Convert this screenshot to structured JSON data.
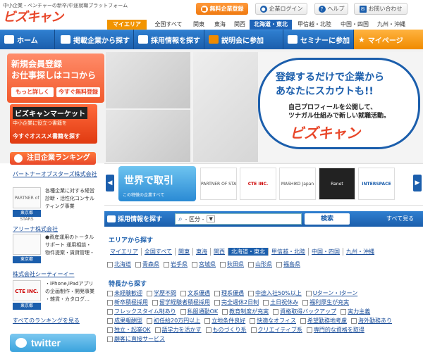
{
  "header": {
    "tagline": "中小企業・ベンチャーの新卒/中途就職プラットフォーム",
    "logo": "ビズキャン",
    "register_label": "無料企業登録",
    "login_label": "企業ログイン",
    "help_label": "ヘルプ",
    "contact_label": "お問い合わせ"
  },
  "regions": [
    "マイエリア",
    "全国すべて",
    "関東",
    "東海",
    "関西",
    "北海道・東北",
    "甲信越・北陸",
    "中国・四国",
    "九州・沖縄"
  ],
  "nav": {
    "home": "ホーム",
    "companies": "掲載企業から探す",
    "jobs": "採用情報を探す",
    "seminar": "説明会に参加",
    "seminar2": "セミナーに参加",
    "mypage": "マイページ"
  },
  "hero": {
    "signup_line1": "新規会員登録",
    "signup_line2": "お仕事探しはココから",
    "more": "もっと詳しく",
    "free_register": "今すぐ無料登録",
    "market_title": "ビズキャンマーケット",
    "market_sub": "中小企業に役立つ書籍を",
    "market_link": "今すぐオススメ書籍を探す",
    "bubble_line1": "登録するだけで企業から",
    "bubble_line2": "あなたにスカウトも!!",
    "bubble_line3": "自己プロフィールを公開して、",
    "bubble_line4": "ツナガル仕組みで新しい就職活動。",
    "bubble_logo": "ビズキャン"
  },
  "ranking": {
    "title": "注目企業ランキング",
    "items": [
      {
        "name": "パートナーオブスターズ株式会社",
        "logo": "PARTNER of STARS",
        "loc": "東京都",
        "desc": "各種企業に対する経営診断・活性化コンサルティング事業"
      },
      {
        "name": "アリーナ株式会社",
        "logo": "",
        "loc": "東京都",
        "desc": "●資産運用のトータルサポート 運用相談・物件提案・賃貸管理・"
      },
      {
        "name": "株式会社シーティーイー",
        "logo": "CTE INC.",
        "loc": "東京都",
        "desc": "・iPhone,iPadアプリの企画制作・開発事業 ・雑貨・カタログ…"
      }
    ],
    "all_link": "すべてのランキングを見る"
  },
  "twitter": "twitter",
  "strip": {
    "sekai_title": "世界で取引",
    "sekai_sub": "この特徴の企業すべて",
    "logos": [
      "PARTNER OF STARS",
      "CTE INC.",
      "MASHIKO Japan",
      "Ranet",
      "INTERSPACE"
    ]
  },
  "job_search": {
    "title": "採用情報を探す",
    "select": "- 区分 -",
    "search_button": "検索",
    "all_link": "すべて見る"
  },
  "area": {
    "title": "エリアから探す",
    "regions": [
      "マイエリア",
      "全国すべて",
      "関東",
      "東海",
      "関西",
      "北海道・東北",
      "甲信越・北陸",
      "中国・四国",
      "九州・沖縄"
    ],
    "prefectures": [
      "北海道",
      "青森県",
      "岩手県",
      "宮城県",
      "秋田県",
      "山形県",
      "福島県"
    ]
  },
  "features": {
    "title": "特長から探す",
    "rows": [
      [
        "未経験歓迎",
        "学歴不問",
        "文系優遇",
        "理系優遇",
        "中途入社50%以上",
        "Uターン・Iターン"
      ],
      [
        "新卒積極採用",
        "留学経験者積極採用",
        "完全週休2日制",
        "土日祝休み",
        "福利厚生が充実"
      ],
      [
        "フレックスタイム制あり",
        "私服通勤OK",
        "教育制度が充実",
        "資格取得バックアップ",
        "実力主義"
      ],
      [
        "成果報酬型",
        "初任給20万円以上",
        "立地条件良好",
        "快適なオフィス",
        "希望勤務地考慮",
        "海外勤務あり"
      ],
      [
        "独立・起業OK",
        "語学力を活かす",
        "ものづくり系",
        "クリエイティブ系",
        "専門的な資格を取得"
      ],
      [
        "顧客に直接サービス"
      ]
    ]
  }
}
